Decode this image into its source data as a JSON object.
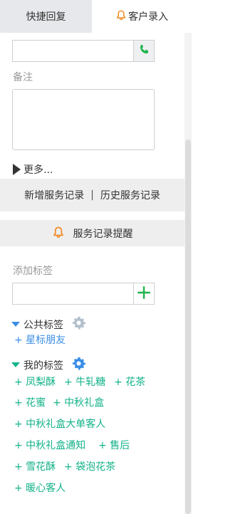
{
  "tabs": {
    "quick_reply": "快捷回复",
    "customer_entry": "客户录入"
  },
  "form": {
    "remark_label": "备注",
    "more_label": "更多..."
  },
  "service": {
    "add_record": "新增服务记录",
    "separator": "|",
    "history_record": "历史服务记录",
    "reminder": "服务记录提醒"
  },
  "tags": {
    "add_label": "添加标签",
    "public_title": "公共标签",
    "public_items": [
      "+ 星标朋友"
    ],
    "my_title": "我的标签",
    "my_items": [
      "+ 凤梨酥",
      "+ 牛轧糖",
      "+ 花茶",
      "+ 花蜜",
      "+ 中秋礼盒",
      "+ 中秋礼盒大单客人",
      "+ 中秋礼盒通知",
      "+ 售后",
      "+ 雪花酥",
      "+ 袋泡花茶",
      "+ 暖心客人"
    ]
  },
  "icons": {
    "bell": "bell-icon",
    "phone": "phone-icon",
    "plus": "plus-icon",
    "gear": "gear-icon"
  },
  "colors": {
    "accent_orange": "#f08a24",
    "tag_blue": "#3a8ee6",
    "tag_green": "#13b28a",
    "phone_green": "#1db34a"
  }
}
